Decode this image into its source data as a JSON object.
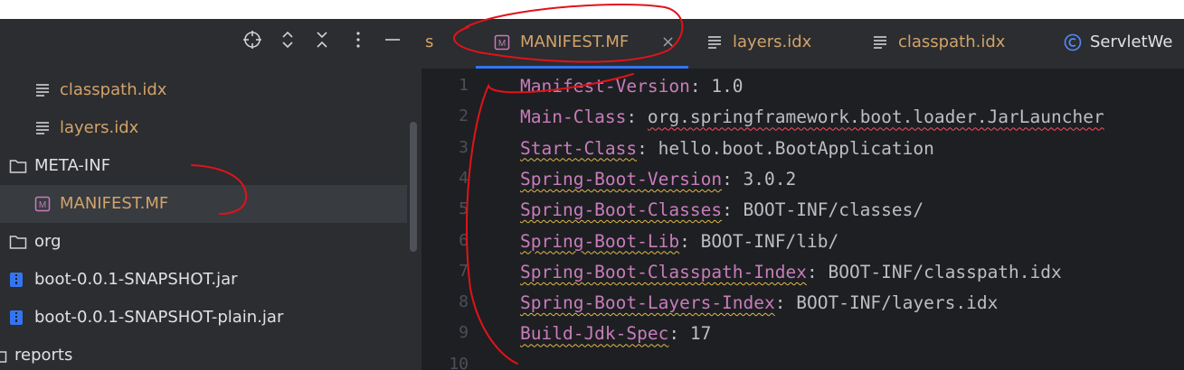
{
  "project": {
    "header_icons": [
      "crosshair-icon",
      "expand-collapse-icon",
      "collapse-all-icon",
      "more-options-icon",
      "hide-panel-icon"
    ],
    "tree": [
      {
        "label": "classpath.idx",
        "icon": "text-file-icon",
        "indent": 2
      },
      {
        "label": "layers.idx",
        "icon": "text-file-icon",
        "indent": 2
      },
      {
        "label": "META-INF",
        "icon": "folder-icon",
        "indent": 1
      },
      {
        "label": "MANIFEST.MF",
        "icon": "manifest-file-icon",
        "indent": 2,
        "selected": true
      },
      {
        "label": "org",
        "icon": "folder-icon",
        "indent": 1
      },
      {
        "label": "boot-0.0.1-SNAPSHOT.jar",
        "icon": "jar-file-icon",
        "indent": 1
      },
      {
        "label": "boot-0.0.1-SNAPSHOT-plain.jar",
        "icon": "jar-file-icon",
        "indent": 1
      },
      {
        "label": "reports",
        "icon": "folder-icon",
        "indent": 0
      }
    ]
  },
  "editor": {
    "tabs": [
      {
        "label": "s",
        "icon": ""
      },
      {
        "label": "MANIFEST.MF",
        "icon": "manifest-file-icon",
        "active": true,
        "close": "×"
      },
      {
        "label": "layers.idx",
        "icon": "text-file-icon"
      },
      {
        "label": "classpath.idx",
        "icon": "text-file-icon"
      },
      {
        "label": "ServletWe",
        "icon": "class-icon"
      }
    ],
    "line_numbers": [
      "1",
      "2",
      "3",
      "4",
      "5",
      "6",
      "7",
      "8",
      "9",
      "10"
    ],
    "lines": [
      {
        "key": "Manifest-Version",
        "sep": ": ",
        "value": "1.0"
      },
      {
        "key": "Main-Class",
        "sep": ": ",
        "value": "org.springframework.boot.loader.JarLauncher",
        "value_error": true
      },
      {
        "key": "Start-Class",
        "sep": ": ",
        "value": "hello.boot.BootApplication",
        "key_warn": true
      },
      {
        "key": "Spring-Boot-Version",
        "sep": ": ",
        "value": "3.0.2",
        "key_warn": true
      },
      {
        "key": "Spring-Boot-Classes",
        "sep": ": ",
        "value": "BOOT-INF/classes/",
        "key_warn": true
      },
      {
        "key": "Spring-Boot-Lib",
        "sep": ": ",
        "value": "BOOT-INF/lib/",
        "key_warn": true
      },
      {
        "key": "Spring-Boot-Classpath-Index",
        "sep": ": ",
        "value": "BOOT-INF/classpath.idx",
        "key_warn": true
      },
      {
        "key": "Spring-Boot-Layers-Index",
        "sep": ": ",
        "value": "BOOT-INF/layers.idx",
        "key_warn": true
      },
      {
        "key": "Build-Jdk-Spec",
        "sep": ": ",
        "value": "17",
        "key_warn": true
      }
    ]
  },
  "colors": {
    "annotation": "#e0131b",
    "key": "#c77dbb",
    "value": "#bcbec4",
    "file_label": "#d2a36a",
    "selection": "#2e436e"
  }
}
